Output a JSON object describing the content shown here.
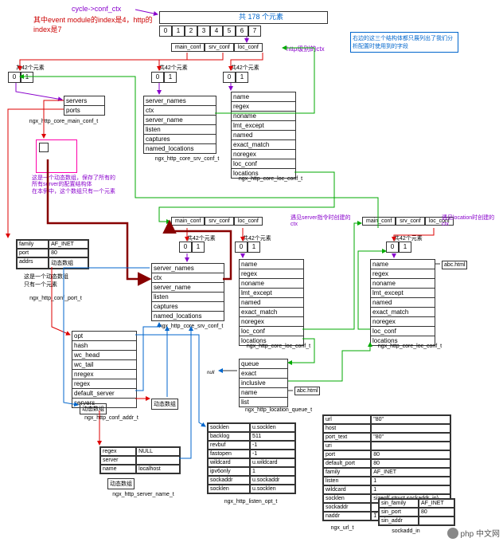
{
  "header": {
    "title": "cycle->conf_ctx",
    "index_note": "其中event module的index是4，http的index是7",
    "array_title": "共 178 个元素",
    "array_cells": [
      "0",
      "1",
      "2",
      "3",
      "4",
      "5",
      "6",
      "7"
    ],
    "conf_sections": [
      "main_conf",
      "srv_conf",
      "loc_conf"
    ],
    "http_level_ctx": "http级别的ctx",
    "right_note": "右边的这三个结构体都只展列出了我们分析配置时使用到的字段",
    "sub42": "共42个元素",
    "sub_cells": [
      "0",
      "1"
    ]
  },
  "core_main": {
    "name": "ngx_http_core_main_conf_t",
    "rows": [
      "servers",
      "ports"
    ]
  },
  "srv1": {
    "name": "ngx_http_core_srv_conf_t",
    "rows": [
      "server_names",
      "ctx",
      "server_name",
      "listen",
      "captures",
      "named_locations"
    ]
  },
  "loc1": {
    "name": "ngx_http_core_loc_conf_t",
    "rows": [
      "name",
      "regex",
      "noname",
      "lmt_except",
      "named",
      "exact_match",
      "noregex",
      "loc_conf",
      "locations"
    ]
  },
  "dyn_note": "这是一个动态数组，保存了所有的所有server的配置结构体\n在本例中，这个数组只有一个元素",
  "mid": {
    "conf_sections": [
      "main_conf",
      "srv_conf",
      "loc_conf"
    ],
    "server_ctx_note": "遇见server指令时创建的ctx",
    "loc_ctx_note": "遇见location时创建的ctx",
    "sub42": "共42个元素",
    "sub_cells": [
      "0",
      "1"
    ]
  },
  "port": {
    "name": "ngx_http_conf_port_t",
    "family_label": "family",
    "family_value": "AF_INET",
    "port_label": "port",
    "port_value": "80",
    "addrs_label": "addrs",
    "addrs_value": "动态数组",
    "note": "这是一个动态数组\n只有一个元素"
  },
  "srv2": {
    "name": "ngx_http_core_srv_conf_t",
    "rows": [
      "server_names",
      "ctx",
      "server_name",
      "listen",
      "captures",
      "named_locations"
    ]
  },
  "loc2": {
    "name": "ngx_http_core_loc_conf_t",
    "rows": [
      "name",
      "regex",
      "noname",
      "lmt_except",
      "named",
      "exact_match",
      "noregex",
      "loc_conf",
      "locations"
    ]
  },
  "loc3": {
    "name": "ngx_http_core_loc_conf_t",
    "rows": [
      "name",
      "regex",
      "noname",
      "lmt_except",
      "named",
      "exact_match",
      "noregex",
      "loc_conf",
      "locations"
    ],
    "side": "abc.html"
  },
  "queue": {
    "name": "ngx_http_location_queue_t",
    "rows": [
      "queue",
      "exact",
      "inclusive",
      "name",
      "list"
    ],
    "null": "null",
    "side": "abc.html"
  },
  "addr": {
    "name": "ngx_http_conf_addr_t",
    "rows": [
      "opt",
      "hash",
      "wc_head",
      "wc_tail",
      "nregex",
      "regex",
      "default_server",
      "servers"
    ],
    "dyn1": "动态数组",
    "dyn2": "动态数组"
  },
  "sname": {
    "name": "ngx_http_server_name_t",
    "r1a": "regex",
    "r1b": "NULL",
    "r2a": "server",
    "r3a": "name",
    "r3b": "localhost",
    "dyn": "动态数组"
  },
  "listen": {
    "name": "ngx_http_listen_opt_t",
    "rows": [
      [
        "socklen",
        "u.socklen"
      ],
      [
        "backlog",
        "511"
      ],
      [
        "revbuf",
        "-1"
      ],
      [
        "fastopen",
        "-1"
      ],
      [
        "wildcard",
        "u.wildcard"
      ],
      [
        "ipv6only",
        "1"
      ],
      [
        "sockaddr",
        "u.sockaddr"
      ],
      [
        "socklen",
        "u.socklen"
      ]
    ]
  },
  "url": {
    "name": "ngx_url_t",
    "rows": [
      [
        "url",
        "\"80\""
      ],
      [
        "host",
        ""
      ],
      [
        "port_text",
        "\"80\""
      ],
      [
        "uri",
        ""
      ],
      [
        "port",
        "80"
      ],
      [
        "default_port",
        "80"
      ],
      [
        "family",
        "AF_INET"
      ],
      [
        "listen",
        "1"
      ],
      [
        "wildcard",
        "1"
      ],
      [
        "socklen",
        "sizeof( struct sockaddr_in)"
      ],
      [
        "sockaddr",
        ""
      ],
      [
        "naddr",
        "1"
      ]
    ],
    "sub_rows": [
      [
        "sin_family",
        "AF_INET"
      ],
      [
        "sin_port",
        "80"
      ],
      [
        "sin_addr",
        ""
      ]
    ],
    "sock": "sockadd_in"
  },
  "watermark": "php 中文网"
}
